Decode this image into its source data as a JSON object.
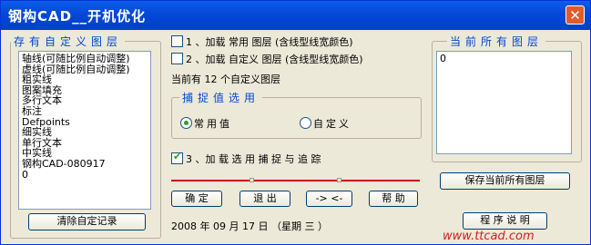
{
  "window": {
    "title": "钢构CAD__开机优化",
    "close": "✕"
  },
  "left_panel": {
    "legend": "存有自定义图层",
    "items": [
      "轴线(可随比例自动调整)",
      "虚线(可随比例自动调整)",
      "粗实线",
      "图案填充",
      "多行文本",
      "标注",
      "Defpoints",
      "细实线",
      "单行文本",
      "中实线",
      "钢构CAD-080917",
      "0"
    ],
    "clear_button": "清除自定记录"
  },
  "options": {
    "opt1": {
      "checked": false,
      "label": "1 、加载 常用 图层 (含线型线宽颜色)"
    },
    "opt2": {
      "checked": false,
      "label": "2 、加载 自定义 图层 (含线型线宽颜色)"
    },
    "current_count": "当前有 12 个自定义图层",
    "snap_group": {
      "legend": "捕捉值选用",
      "common": "常用值",
      "custom": "自定义",
      "selected": "common"
    },
    "opt3": {
      "checked": true,
      "label": "3 、加 载 选 用 捕 捉 与 追 踪"
    }
  },
  "buttons": {
    "ok": "确 定",
    "exit": "退 出",
    "arrow": "-> <-",
    "help": "帮 助"
  },
  "date": "2008 年 09 月 17 日 （星期 三 ）",
  "right_panel": {
    "legend": "当前所有图层",
    "items": [
      "0"
    ],
    "save_button": "保存当前所有图层",
    "about_button": "程 序 说 明"
  },
  "watermark": "www.ttcad.com",
  "colors": {
    "title_bar": "#0548d8",
    "legend": "#0046d5",
    "divider": "#d00000"
  }
}
